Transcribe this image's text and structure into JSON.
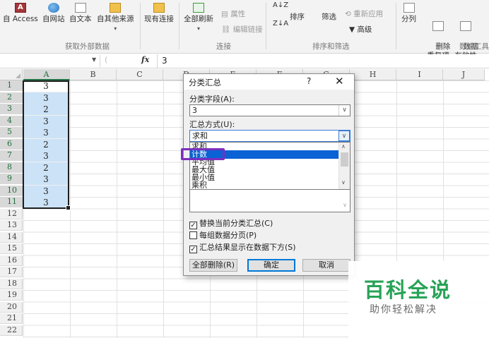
{
  "ribbon": {
    "get_external": {
      "buttons": [
        "自 Access",
        "自网站",
        "自文本",
        "自其他来源"
      ],
      "label": "获取外部数据"
    },
    "existing_connections": "现有连接",
    "connections": {
      "refresh_all": "全部刷新",
      "properties": "属性",
      "edit_links": "编辑链接",
      "label": "连接"
    },
    "sort_filter": {
      "sort": "排序",
      "filter": "筛选",
      "reapply": "重新应用",
      "advanced": "高级",
      "label": "排序和筛选"
    },
    "data_tools": {
      "text_to_columns": "分列",
      "remove_duplicates": "删除\n重复项",
      "validation": "数据\n有效性",
      "label": "数据工具"
    }
  },
  "formula_bar": {
    "fx": "fx",
    "value": "3"
  },
  "grid": {
    "columns": [
      "A",
      "B",
      "C",
      "D",
      "E",
      "F",
      "G",
      "H",
      "I",
      "J"
    ],
    "rows": [
      "1",
      "2",
      "3",
      "4",
      "5",
      "6",
      "7",
      "8",
      "9",
      "10",
      "11",
      "12",
      "13",
      "14",
      "15",
      "16",
      "17",
      "18",
      "19",
      "20",
      "21",
      "22"
    ],
    "column_a_values": [
      "3",
      "3",
      "2",
      "3",
      "3",
      "2",
      "3",
      "2",
      "3",
      "3",
      "3"
    ]
  },
  "dialog": {
    "title": "分类汇总",
    "help": "?",
    "close": "✕",
    "group_by_label": "分类字段(A):",
    "group_by_value": "3",
    "function_label": "汇总方式(U):",
    "function_value": "求和",
    "function_options": [
      "求和",
      "计数",
      "平均值",
      "最大值",
      "最小值",
      "乘积"
    ],
    "highlighted_option": "计数",
    "replace_current": "替换当前分类汇总(C)",
    "page_break": "每组数据分页(P)",
    "summary_below": "汇总结果显示在数据下方(S)",
    "remove_all": "全部删除(R)",
    "ok": "确定",
    "cancel": "取消"
  },
  "watermark": {
    "title": "百科全说",
    "subtitle": "助你轻松解决"
  }
}
